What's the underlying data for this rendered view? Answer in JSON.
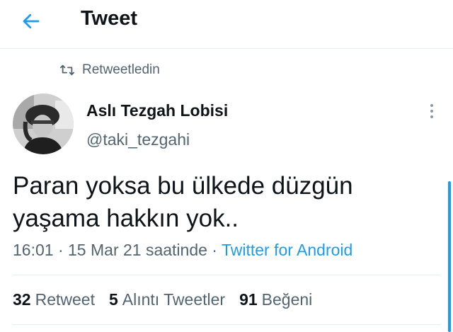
{
  "header": {
    "title": "Tweet",
    "back_icon": "arrow-left-icon"
  },
  "social_context": {
    "icon": "retweet-icon",
    "label": "Retweetledin"
  },
  "tweet": {
    "author": {
      "display_name": "Aslı Tezgah Lobisi",
      "username": "@taki_tezgahi"
    },
    "text": "Paran yoksa bu ülkede düzgün\nyaşama hakkın yok..",
    "time": "16:01",
    "separator1": " · ",
    "date": "15 Mar 21 saatinde",
    "separator2": " · ",
    "source": "Twitter for Android"
  },
  "stats": {
    "retweets_count": "32",
    "retweets_label": "Retweet",
    "quotes_count": "5",
    "quotes_label": "Alıntı Tweetler",
    "likes_count": "91",
    "likes_label": "Beğeni"
  },
  "colors": {
    "accent": "#1d9bf0",
    "text_primary": "#0f1419",
    "text_secondary": "#536471",
    "border": "#e6ecf0"
  }
}
